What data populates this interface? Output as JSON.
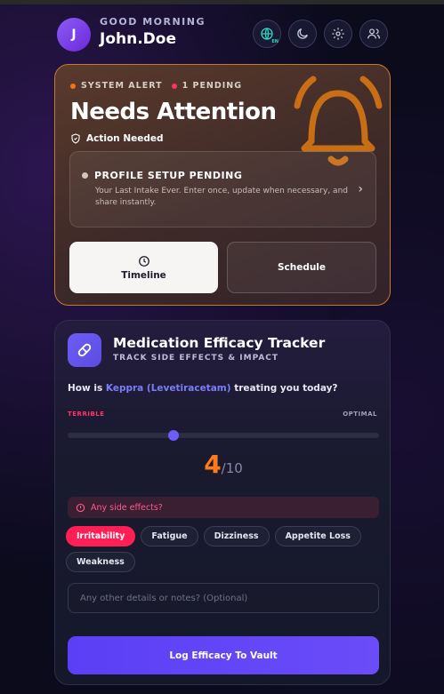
{
  "header": {
    "avatar_initial": "J",
    "greeting": "GOOD MORNING",
    "username": "John.Doe",
    "language_badge": "EN",
    "icons": [
      "globe-icon",
      "moon-icon",
      "gear-icon",
      "users-icon"
    ]
  },
  "alert": {
    "system_label": "SYSTEM ALERT",
    "pending_label": "1 PENDING",
    "title": "Needs Attention",
    "status": "Action Needed",
    "profile_title": "PROFILE SETUP PENDING",
    "profile_desc": "Your Last Intake Ever. Enter once, update when necessary, and share instantly.",
    "timeline_label": "Timeline",
    "schedule_label": "Schedule",
    "colors": {
      "system_dot": "#f97316",
      "pending_dot": "#ff3366",
      "bell": "#e07a12"
    }
  },
  "tracker": {
    "title": "Medication Efficacy Tracker",
    "subtitle": "TRACK SIDE EFFECTS & IMPACT",
    "question_prefix": "How is ",
    "medication": "Keppra (Levetiracetam)",
    "question_suffix": " treating you today?",
    "label_low": "TERRIBLE",
    "label_high": "OPTIMAL",
    "score": "4",
    "score_max": "/10",
    "score_fraction": 0.34,
    "side_effects_label": "Any side effects?",
    "side_effects": [
      {
        "label": "Irritability",
        "active": true
      },
      {
        "label": "Fatigue",
        "active": false
      },
      {
        "label": "Dizziness",
        "active": false
      },
      {
        "label": "Appetite Loss",
        "active": false
      },
      {
        "label": "Weakness",
        "active": false
      }
    ],
    "notes_placeholder": "Any other details or notes? (Optional)",
    "submit_label": "Log Efficacy To Vault"
  }
}
